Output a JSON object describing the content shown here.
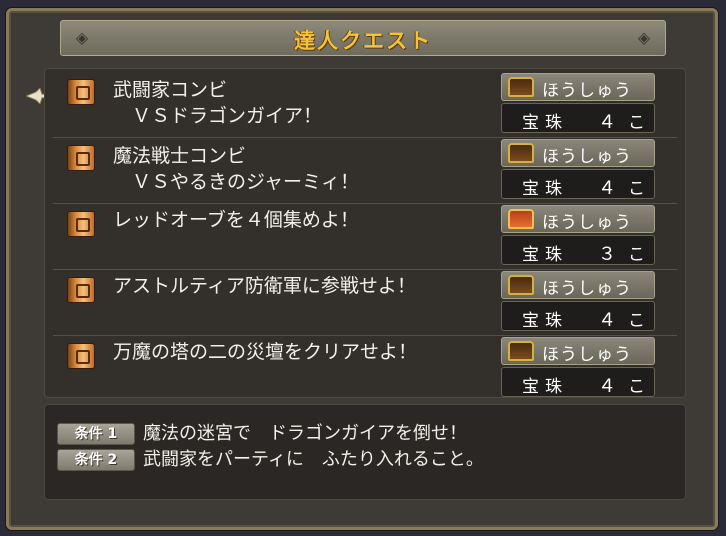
{
  "window": {
    "title": "達人クエスト"
  },
  "quests": [
    {
      "name": "武闘家コンビ\n　ＶＳドラゴンガイア！",
      "reward_label": "ほうしゅう",
      "reward_item": "宝珠",
      "reward_count": "４",
      "reward_unit": "こ",
      "chest_color": "brown"
    },
    {
      "name": "魔法戦士コンビ\n　ＶＳやるきのジャーミィ！",
      "reward_label": "ほうしゅう",
      "reward_item": "宝珠",
      "reward_count": "４",
      "reward_unit": "こ",
      "chest_color": "brown"
    },
    {
      "name": "レッドオーブを４個集めよ！",
      "reward_label": "ほうしゅう",
      "reward_item": "宝珠",
      "reward_count": "３",
      "reward_unit": "こ",
      "chest_color": "red"
    },
    {
      "name": "アストルティア防衛軍に参戦せよ！",
      "reward_label": "ほうしゅう",
      "reward_item": "宝珠",
      "reward_count": "４",
      "reward_unit": "こ",
      "chest_color": "brown"
    },
    {
      "name": "万魔の塔の二の災壇をクリアせよ！",
      "reward_label": "ほうしゅう",
      "reward_item": "宝珠",
      "reward_count": "４",
      "reward_unit": "こ",
      "chest_color": "brown"
    }
  ],
  "conditions": [
    {
      "tag": "条件 1",
      "text": "魔法の迷宮で　ドラゴンガイアを倒せ！"
    },
    {
      "tag": "条件 2",
      "text": "武闘家をパーティに　ふたり入れること。"
    }
  ],
  "colors": {
    "title_gold": "#f5c23a",
    "panel_bg": "#33302c",
    "text": "#f2f0ea"
  }
}
